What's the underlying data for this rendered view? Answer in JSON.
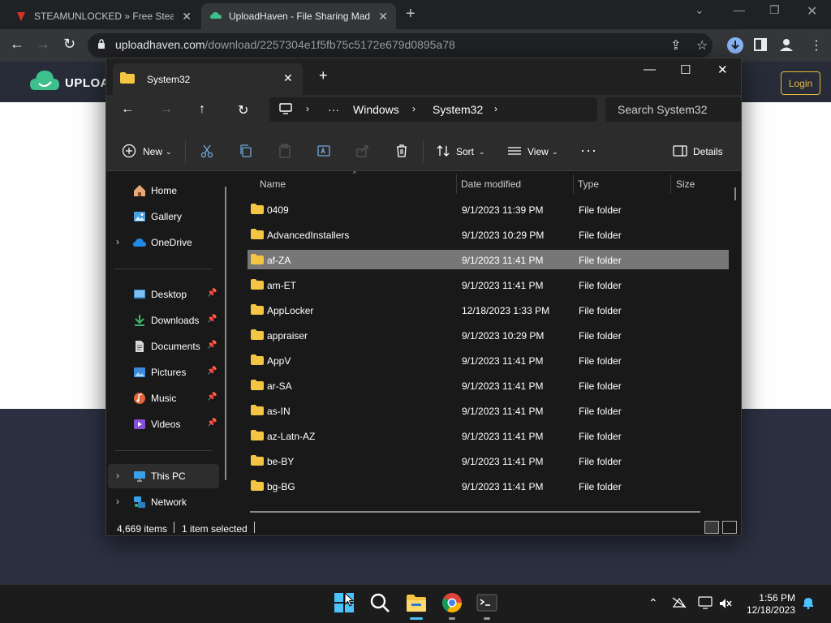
{
  "browser": {
    "tabs": [
      {
        "title": "STEAMUNLOCKED » Free Steam G",
        "active": false
      },
      {
        "title": "UploadHaven - File Sharing Made",
        "active": true
      }
    ],
    "url_host": "uploadhaven.com",
    "url_path": "/download/2257304e1f5fb75c5172e679d0895a78"
  },
  "page": {
    "logo_text": "UPLOAD",
    "login_label": "Login"
  },
  "explorer": {
    "tab_title": "System32",
    "breadcrumb": [
      "Windows",
      "System32"
    ],
    "search_placeholder": "Search System32",
    "commands": {
      "new": "New",
      "sort": "Sort",
      "view": "View",
      "details": "Details"
    },
    "nav": {
      "home": "Home",
      "gallery": "Gallery",
      "onedrive": "OneDrive",
      "desktop": "Desktop",
      "downloads": "Downloads",
      "documents": "Documents",
      "pictures": "Pictures",
      "music": "Music",
      "videos": "Videos",
      "thispc": "This PC",
      "network": "Network"
    },
    "columns": {
      "name": "Name",
      "date": "Date modified",
      "type": "Type",
      "size": "Size"
    },
    "rows": [
      {
        "name": "0409",
        "date": "9/1/2023 11:39 PM",
        "type": "File folder"
      },
      {
        "name": "AdvancedInstallers",
        "date": "9/1/2023 10:29 PM",
        "type": "File folder"
      },
      {
        "name": "af-ZA",
        "date": "9/1/2023 11:41 PM",
        "type": "File folder"
      },
      {
        "name": "am-ET",
        "date": "9/1/2023 11:41 PM",
        "type": "File folder"
      },
      {
        "name": "AppLocker",
        "date": "12/18/2023 1:33 PM",
        "type": "File folder"
      },
      {
        "name": "appraiser",
        "date": "9/1/2023 10:29 PM",
        "type": "File folder"
      },
      {
        "name": "AppV",
        "date": "9/1/2023 11:41 PM",
        "type": "File folder"
      },
      {
        "name": "ar-SA",
        "date": "9/1/2023 11:41 PM",
        "type": "File folder"
      },
      {
        "name": "as-IN",
        "date": "9/1/2023 11:41 PM",
        "type": "File folder"
      },
      {
        "name": "az-Latn-AZ",
        "date": "9/1/2023 11:41 PM",
        "type": "File folder"
      },
      {
        "name": "be-BY",
        "date": "9/1/2023 11:41 PM",
        "type": "File folder"
      },
      {
        "name": "bg-BG",
        "date": "9/1/2023 11:41 PM",
        "type": "File folder"
      }
    ],
    "selected_row": "af-ZA",
    "status": {
      "count": "4,669 items",
      "selected": "1 item selected"
    }
  },
  "taskbar": {
    "time": "1:56 PM",
    "date": "12/18/2023"
  },
  "colors": {
    "selection": "#777777",
    "folder": "#f4c542",
    "accent": "#e5b93a"
  }
}
